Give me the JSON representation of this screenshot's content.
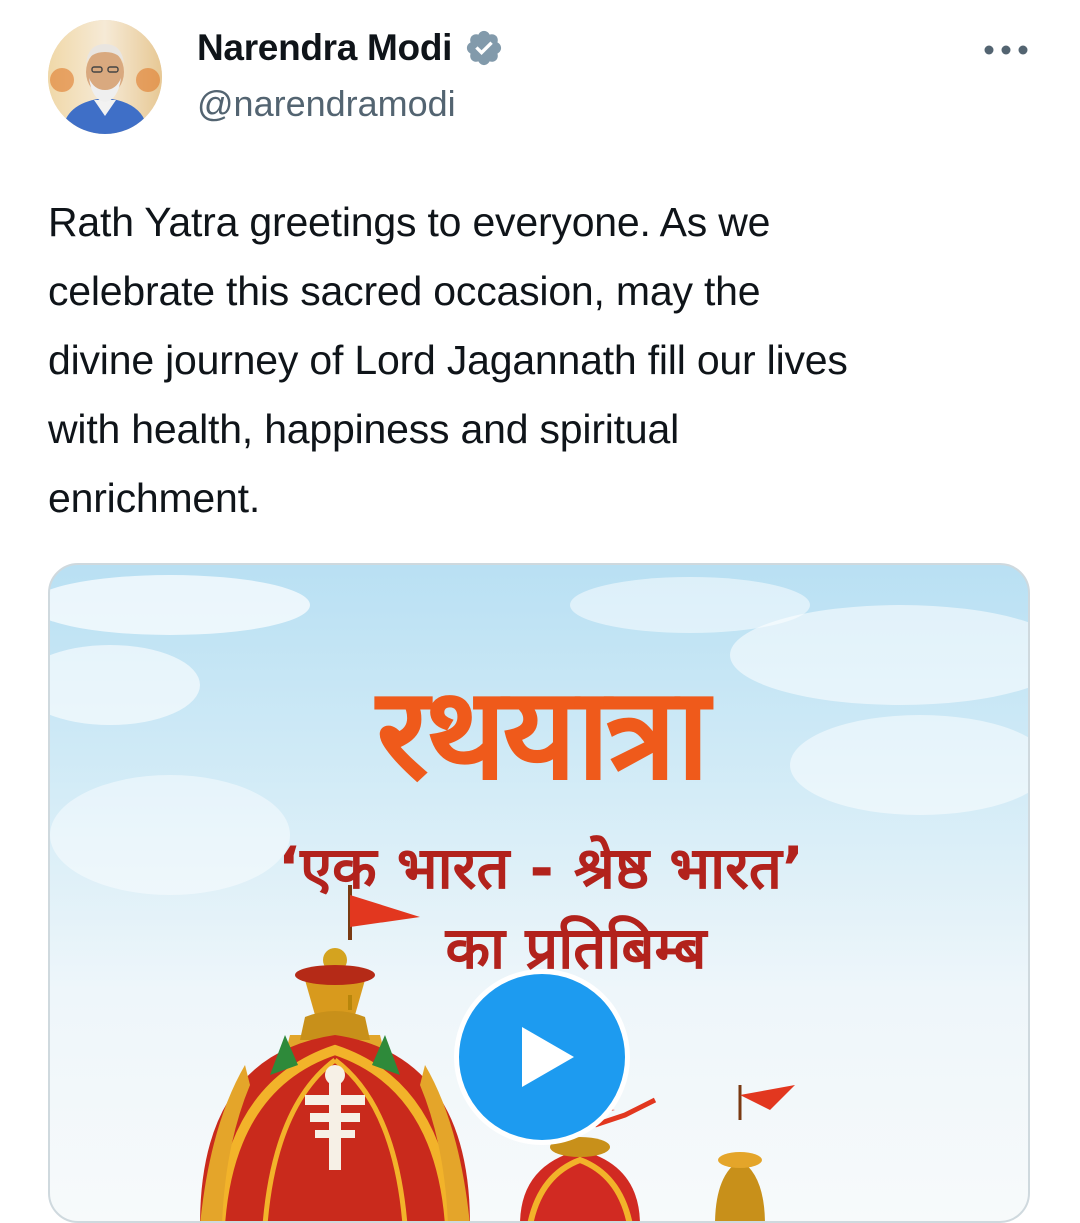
{
  "author": {
    "name": "Narendra Modi",
    "handle": "@narendramodi",
    "verified": true
  },
  "icons": {
    "verified": "verified-badge-icon",
    "more": "more-options-icon",
    "play": "play-icon"
  },
  "tweet": {
    "text": "Rath Yatra greetings to everyone. As we\ncelebrate this sacred occasion, may the\ndivine journey of Lord Jagannath fill our lives\nwith health, happiness and spiritual\nenrichment."
  },
  "media": {
    "type": "video",
    "title": "रथयात्रा",
    "subtitle_line1": "‘एक भारत - श्रेष्ठ भारत’",
    "subtitle_line2": "का प्रतिबिम्ब"
  },
  "colors": {
    "accent": "#1d9bf0",
    "text_primary": "#0f1419",
    "text_secondary": "#536471",
    "border": "#cfd9de",
    "title_orange": "#ef5a1b",
    "subtitle_red": "#b2221c",
    "verified_badge": "#829aab"
  }
}
